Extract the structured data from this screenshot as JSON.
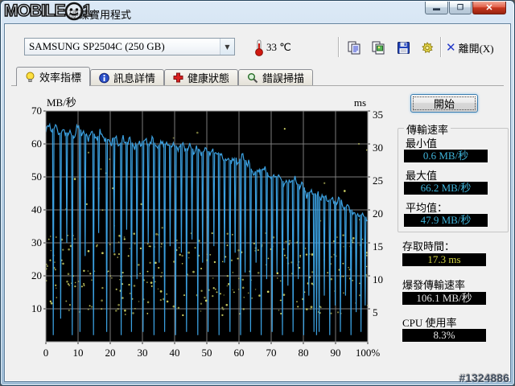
{
  "window": {
    "title": "硬碟實用程式",
    "watermark_logo": "mobile01",
    "post_id": "#1324886",
    "controls": [
      "minimize",
      "maximize",
      "close"
    ]
  },
  "toolbar": {
    "drive_select": {
      "value": "SAMSUNG SP2504C (250 GB)"
    },
    "temperature": "33 ℃",
    "buttons": [
      "copy-text",
      "copy-image",
      "save",
      "options"
    ],
    "exit_label": "離開(X)"
  },
  "tabs": [
    {
      "label": "效率指標",
      "icon": "lightbulb-icon",
      "active": true
    },
    {
      "label": "訊息詳情",
      "icon": "info-icon",
      "active": false
    },
    {
      "label": "健康狀態",
      "icon": "health-cross-icon",
      "active": false
    },
    {
      "label": "錯誤掃描",
      "icon": "magnifier-icon",
      "active": false
    }
  ],
  "benchmark": {
    "start_button": "開始",
    "transfer_group": {
      "title": "傳輸速率",
      "min_label": "最小值",
      "min_value": "0.6 MB/秒",
      "max_label": "最大值",
      "max_value": "66.2 MB/秒",
      "avg_label": "平均值：",
      "avg_value": "47.9 MB/秒"
    },
    "access_time_label": "存取時間：",
    "access_time_value": "17.3 ms",
    "burst_label": "爆發傳輸速率",
    "burst_value": "106.1 MB/秒",
    "cpu_label": "CPU 使用率",
    "cpu_value": "8.3%"
  },
  "colors": {
    "value_cyan": "#3fb4da",
    "value_yellow": "#d4d442",
    "value_white": "#e6e6e6",
    "close_red": "#c83820"
  },
  "chart_data": {
    "type": "line+scatter",
    "title": "",
    "x_axis": {
      "min": 0,
      "max": 100,
      "tick_step": 10,
      "tick_labels": [
        "0",
        "10",
        "20",
        "30",
        "40",
        "50",
        "60",
        "70",
        "80",
        "90",
        "100%"
      ]
    },
    "y_left": {
      "label": "MB/秒",
      "min": 0,
      "max": 70,
      "tick_step": 10,
      "ticks": [
        70,
        60,
        50,
        40,
        30,
        20,
        10
      ]
    },
    "y_right": {
      "label": "ms",
      "min": 0,
      "max": 35,
      "tick_step": 5,
      "ticks": [
        35,
        30,
        25,
        20,
        15,
        10,
        5
      ]
    },
    "bg": "#000000",
    "grid_color": "#7d7d7d",
    "border_color": "#989898",
    "series": [
      {
        "name": "transfer-rate",
        "unit": "MB/秒",
        "color": "#3ba0e0",
        "trend": [
          [
            0,
            63.5
          ],
          [
            1,
            65.5
          ],
          [
            2,
            64.5
          ],
          [
            3,
            65
          ],
          [
            4,
            64
          ],
          [
            5,
            63
          ],
          [
            6,
            64
          ],
          [
            7,
            63
          ],
          [
            8,
            62.5
          ],
          [
            9,
            63
          ],
          [
            10,
            65
          ],
          [
            11,
            64
          ],
          [
            12,
            63
          ],
          [
            13,
            62
          ],
          [
            14,
            63.5
          ],
          [
            15,
            63
          ],
          [
            16,
            62
          ],
          [
            17,
            63
          ],
          [
            18,
            62.5
          ],
          [
            19,
            61
          ],
          [
            20,
            60.5
          ],
          [
            21,
            62
          ],
          [
            22,
            61
          ],
          [
            23,
            60
          ],
          [
            24,
            61
          ],
          [
            25,
            60.5
          ],
          [
            26,
            61
          ],
          [
            27,
            60
          ],
          [
            28,
            59.5
          ],
          [
            29,
            60
          ],
          [
            30,
            61
          ],
          [
            31,
            60.5
          ],
          [
            32,
            60
          ],
          [
            33,
            61
          ],
          [
            34,
            60
          ],
          [
            35,
            59.5
          ],
          [
            36,
            60.5
          ],
          [
            37,
            60
          ],
          [
            38,
            59
          ],
          [
            39,
            60
          ],
          [
            40,
            59.5
          ],
          [
            41,
            59
          ],
          [
            42,
            60
          ],
          [
            43,
            59
          ],
          [
            44,
            58.5
          ],
          [
            45,
            59
          ],
          [
            46,
            58
          ],
          [
            47,
            58.5
          ],
          [
            48,
            58
          ],
          [
            49,
            57.5
          ],
          [
            50,
            58
          ],
          [
            51,
            57.5
          ],
          [
            52,
            57
          ],
          [
            53,
            58
          ],
          [
            54,
            57
          ],
          [
            55,
            56
          ],
          [
            56,
            54.5
          ],
          [
            57,
            55
          ],
          [
            58,
            55.5
          ],
          [
            59,
            54.5
          ],
          [
            60,
            55
          ],
          [
            61,
            56
          ],
          [
            62,
            55
          ],
          [
            63,
            54
          ],
          [
            64,
            51.5
          ],
          [
            65,
            52
          ],
          [
            66,
            51
          ],
          [
            67,
            52.5
          ],
          [
            68,
            52
          ],
          [
            69,
            51
          ],
          [
            70,
            50
          ],
          [
            71,
            50.5
          ],
          [
            72,
            50
          ],
          [
            73,
            49
          ],
          [
            74,
            48.5
          ],
          [
            75,
            48
          ],
          [
            76,
            49.5
          ],
          [
            77,
            49
          ],
          [
            78,
            48
          ],
          [
            79,
            47.5
          ],
          [
            80,
            47
          ],
          [
            81,
            45
          ],
          [
            82,
            45.5
          ],
          [
            83,
            45
          ],
          [
            84,
            44.5
          ],
          [
            85,
            44
          ],
          [
            86,
            44.5
          ],
          [
            87,
            43.5
          ],
          [
            88,
            43
          ],
          [
            89,
            42.5
          ],
          [
            90,
            42.5
          ],
          [
            91,
            43
          ],
          [
            92,
            42
          ],
          [
            93,
            41
          ],
          [
            94,
            40.5
          ],
          [
            95,
            40
          ],
          [
            96,
            38
          ],
          [
            97,
            39
          ],
          [
            98,
            38.5
          ],
          [
            99,
            38
          ],
          [
            100,
            37.5
          ]
        ],
        "spikes": [
          [
            2.3,
            2
          ],
          [
            4.6,
            7
          ],
          [
            6.5,
            30
          ],
          [
            8.2,
            2
          ],
          [
            10.6,
            3
          ],
          [
            12.2,
            26
          ],
          [
            14.8,
            2
          ],
          [
            16.4,
            33
          ],
          [
            18.9,
            3
          ],
          [
            21.2,
            27
          ],
          [
            23.4,
            2
          ],
          [
            25.1,
            34
          ],
          [
            26.6,
            3
          ],
          [
            28.3,
            19
          ],
          [
            30.2,
            3
          ],
          [
            31.8,
            30
          ],
          [
            33.6,
            2
          ],
          [
            35.2,
            24
          ],
          [
            36.9,
            3
          ],
          [
            38.6,
            29
          ],
          [
            40.3,
            2
          ],
          [
            42.1,
            27
          ],
          [
            43.7,
            3
          ],
          [
            45.4,
            31
          ],
          [
            47.2,
            2
          ],
          [
            48.7,
            24
          ],
          [
            50.4,
            3
          ],
          [
            52.2,
            29
          ],
          [
            53.8,
            2
          ],
          [
            55.5,
            24
          ],
          [
            57.2,
            3
          ],
          [
            58.8,
            27
          ],
          [
            60.5,
            2
          ],
          [
            61.9,
            21
          ],
          [
            63.6,
            3
          ],
          [
            65.3,
            24
          ],
          [
            66.9,
            2
          ],
          [
            68.6,
            19
          ],
          [
            70.3,
            3
          ],
          [
            71.8,
            21
          ],
          [
            73.5,
            2
          ],
          [
            75.2,
            17
          ],
          [
            76.8,
            3
          ],
          [
            78.4,
            19
          ],
          [
            80.1,
            2
          ],
          [
            81.7,
            14
          ],
          [
            83.3,
            3
          ],
          [
            84.1,
            2
          ],
          [
            84.9,
            3
          ],
          [
            86.5,
            14
          ],
          [
            88.2,
            2
          ],
          [
            89.9,
            11
          ],
          [
            91.5,
            3
          ],
          [
            93.1,
            14
          ],
          [
            94.8,
            2
          ],
          [
            96.4,
            9
          ],
          [
            97.9,
            3
          ],
          [
            99.2,
            11
          ]
        ]
      },
      {
        "name": "access-time-dots",
        "unit": "ms",
        "color": "#d8dc6a",
        "count": 330,
        "seed": 12,
        "y_min": 4,
        "y_max": 16.5,
        "outlier_rate": 0.06,
        "outlier_max": 33
      }
    ],
    "readouts": {
      "min": 0.6,
      "max": 66.2,
      "avg": 47.9,
      "access_ms": 17.3,
      "burst": 106.1,
      "cpu_pct": 8.3
    }
  }
}
